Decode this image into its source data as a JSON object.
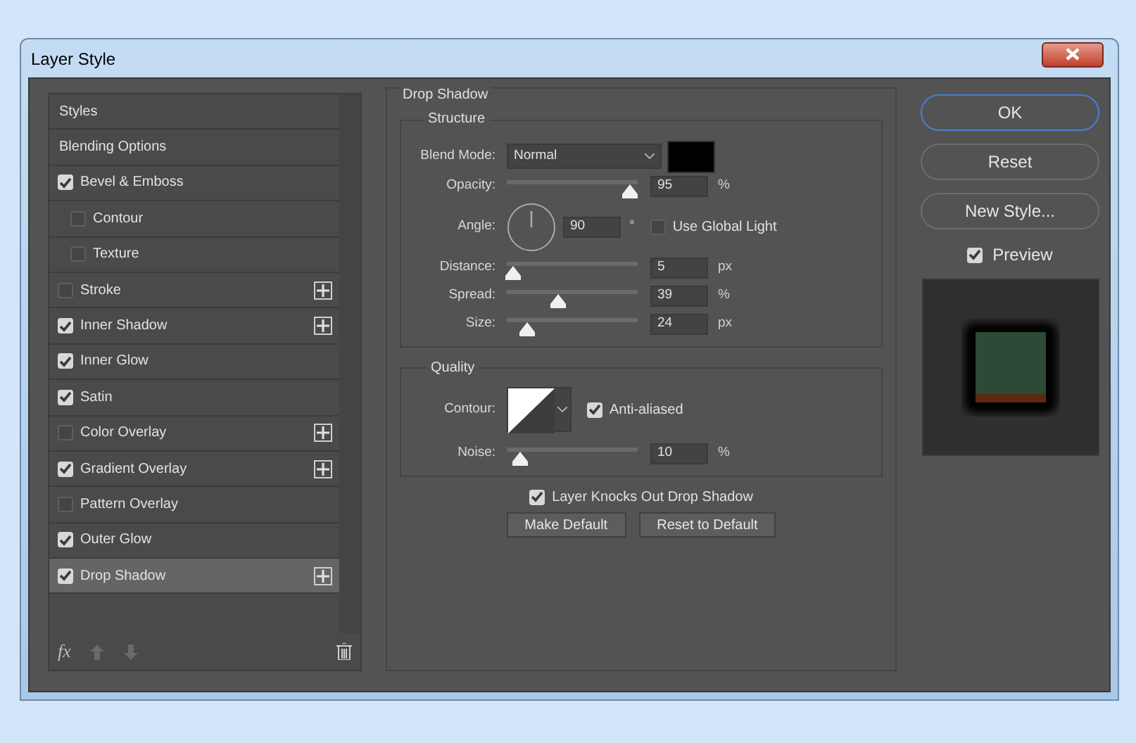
{
  "window": {
    "title": "Layer Style"
  },
  "styles_list": [
    {
      "label": "Styles",
      "kind": "header",
      "selected": false
    },
    {
      "label": "Blending Options",
      "kind": "header",
      "selected": false
    },
    {
      "label": "Bevel & Emboss",
      "kind": "effect",
      "checked": true,
      "selected": false,
      "addable": false,
      "children": [
        {
          "label": "Contour",
          "kind": "effect",
          "checked": false,
          "selected": false,
          "addable": false
        },
        {
          "label": "Texture",
          "kind": "effect",
          "checked": false,
          "selected": false,
          "addable": false
        }
      ]
    },
    {
      "label": "Stroke",
      "kind": "effect",
      "checked": false,
      "selected": false,
      "addable": true
    },
    {
      "label": "Inner Shadow",
      "kind": "effect",
      "checked": true,
      "selected": false,
      "addable": true
    },
    {
      "label": "Inner Glow",
      "kind": "effect",
      "checked": true,
      "selected": false,
      "addable": false
    },
    {
      "label": "Satin",
      "kind": "effect",
      "checked": true,
      "selected": false,
      "addable": false
    },
    {
      "label": "Color Overlay",
      "kind": "effect",
      "checked": false,
      "selected": false,
      "addable": true
    },
    {
      "label": "Gradient Overlay",
      "kind": "effect",
      "checked": true,
      "selected": false,
      "addable": true
    },
    {
      "label": "Pattern Overlay",
      "kind": "effect",
      "checked": false,
      "selected": false,
      "addable": false
    },
    {
      "label": "Outer Glow",
      "kind": "effect",
      "checked": true,
      "selected": false,
      "addable": false
    },
    {
      "label": "Drop Shadow",
      "kind": "effect",
      "checked": true,
      "selected": true,
      "addable": true
    }
  ],
  "list_toolbar": {
    "fx": "fx"
  },
  "panel": {
    "title": "Drop Shadow",
    "structure": {
      "title": "Structure",
      "blend_mode": {
        "label": "Blend Mode:",
        "value": "Normal"
      },
      "opacity": {
        "label": "Opacity:",
        "level": 0.94,
        "value": "95",
        "unit": "%"
      },
      "angle": {
        "label": "Angle:",
        "value": "90",
        "unit": "°"
      },
      "use_global_light": {
        "label": "Use Global Light",
        "checked": false
      },
      "sliders": [
        {
          "label": "Distance:",
          "level": 0.04,
          "value": "5",
          "unit": "px"
        },
        {
          "label": "Spread:",
          "level": 0.39,
          "value": "39",
          "unit": "%"
        },
        {
          "label": "Size:",
          "level": 0.15,
          "value": "24",
          "unit": "px"
        }
      ]
    },
    "quality": {
      "title": "Quality",
      "contour_label": "Contour:",
      "anti_aliased": {
        "label": "Anti-aliased",
        "checked": true
      },
      "noise": {
        "label": "Noise:",
        "level": 0.1,
        "value": "10",
        "unit": "%"
      }
    },
    "knockout": {
      "label": "Layer Knocks Out Drop Shadow",
      "checked": true
    },
    "buttons": [
      "Make Default",
      "Reset to Default"
    ]
  },
  "side_buttons": [
    {
      "label": "OK",
      "default": true
    },
    {
      "label": "Reset",
      "default": false
    },
    {
      "label": "New Style...",
      "default": false
    }
  ],
  "preview": {
    "label": "Preview",
    "checked": true
  }
}
